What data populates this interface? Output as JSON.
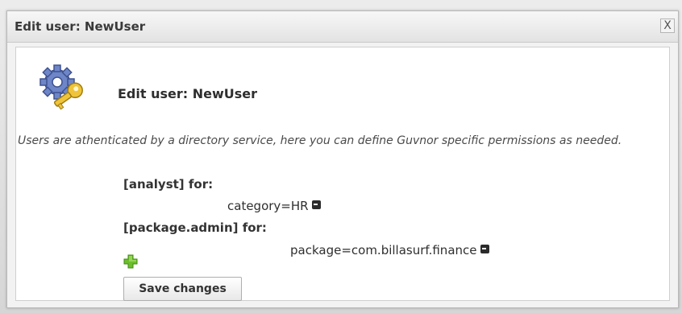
{
  "dialog": {
    "title": "Edit user: NewUser",
    "close_label": "X"
  },
  "content": {
    "heading": "Edit user: NewUser",
    "description": "Users are athenticated by a directory service, here you can define Guvnor specific permissions as needed."
  },
  "permissions": [
    {
      "role": "[analyst] for:",
      "target": "category=HR"
    },
    {
      "role": "[package.admin] for:",
      "target": "package=com.billasurf.finance"
    }
  ],
  "actions": {
    "save_label": "Save changes"
  },
  "icons": {
    "user": "user-settings-icon",
    "add": "plus-icon",
    "remove": "remove-icon",
    "close": "close-icon"
  },
  "colors": {
    "add_green": "#6cbf2a",
    "gear_blue": "#5a73b7",
    "key_yellow": "#e6b82b"
  }
}
